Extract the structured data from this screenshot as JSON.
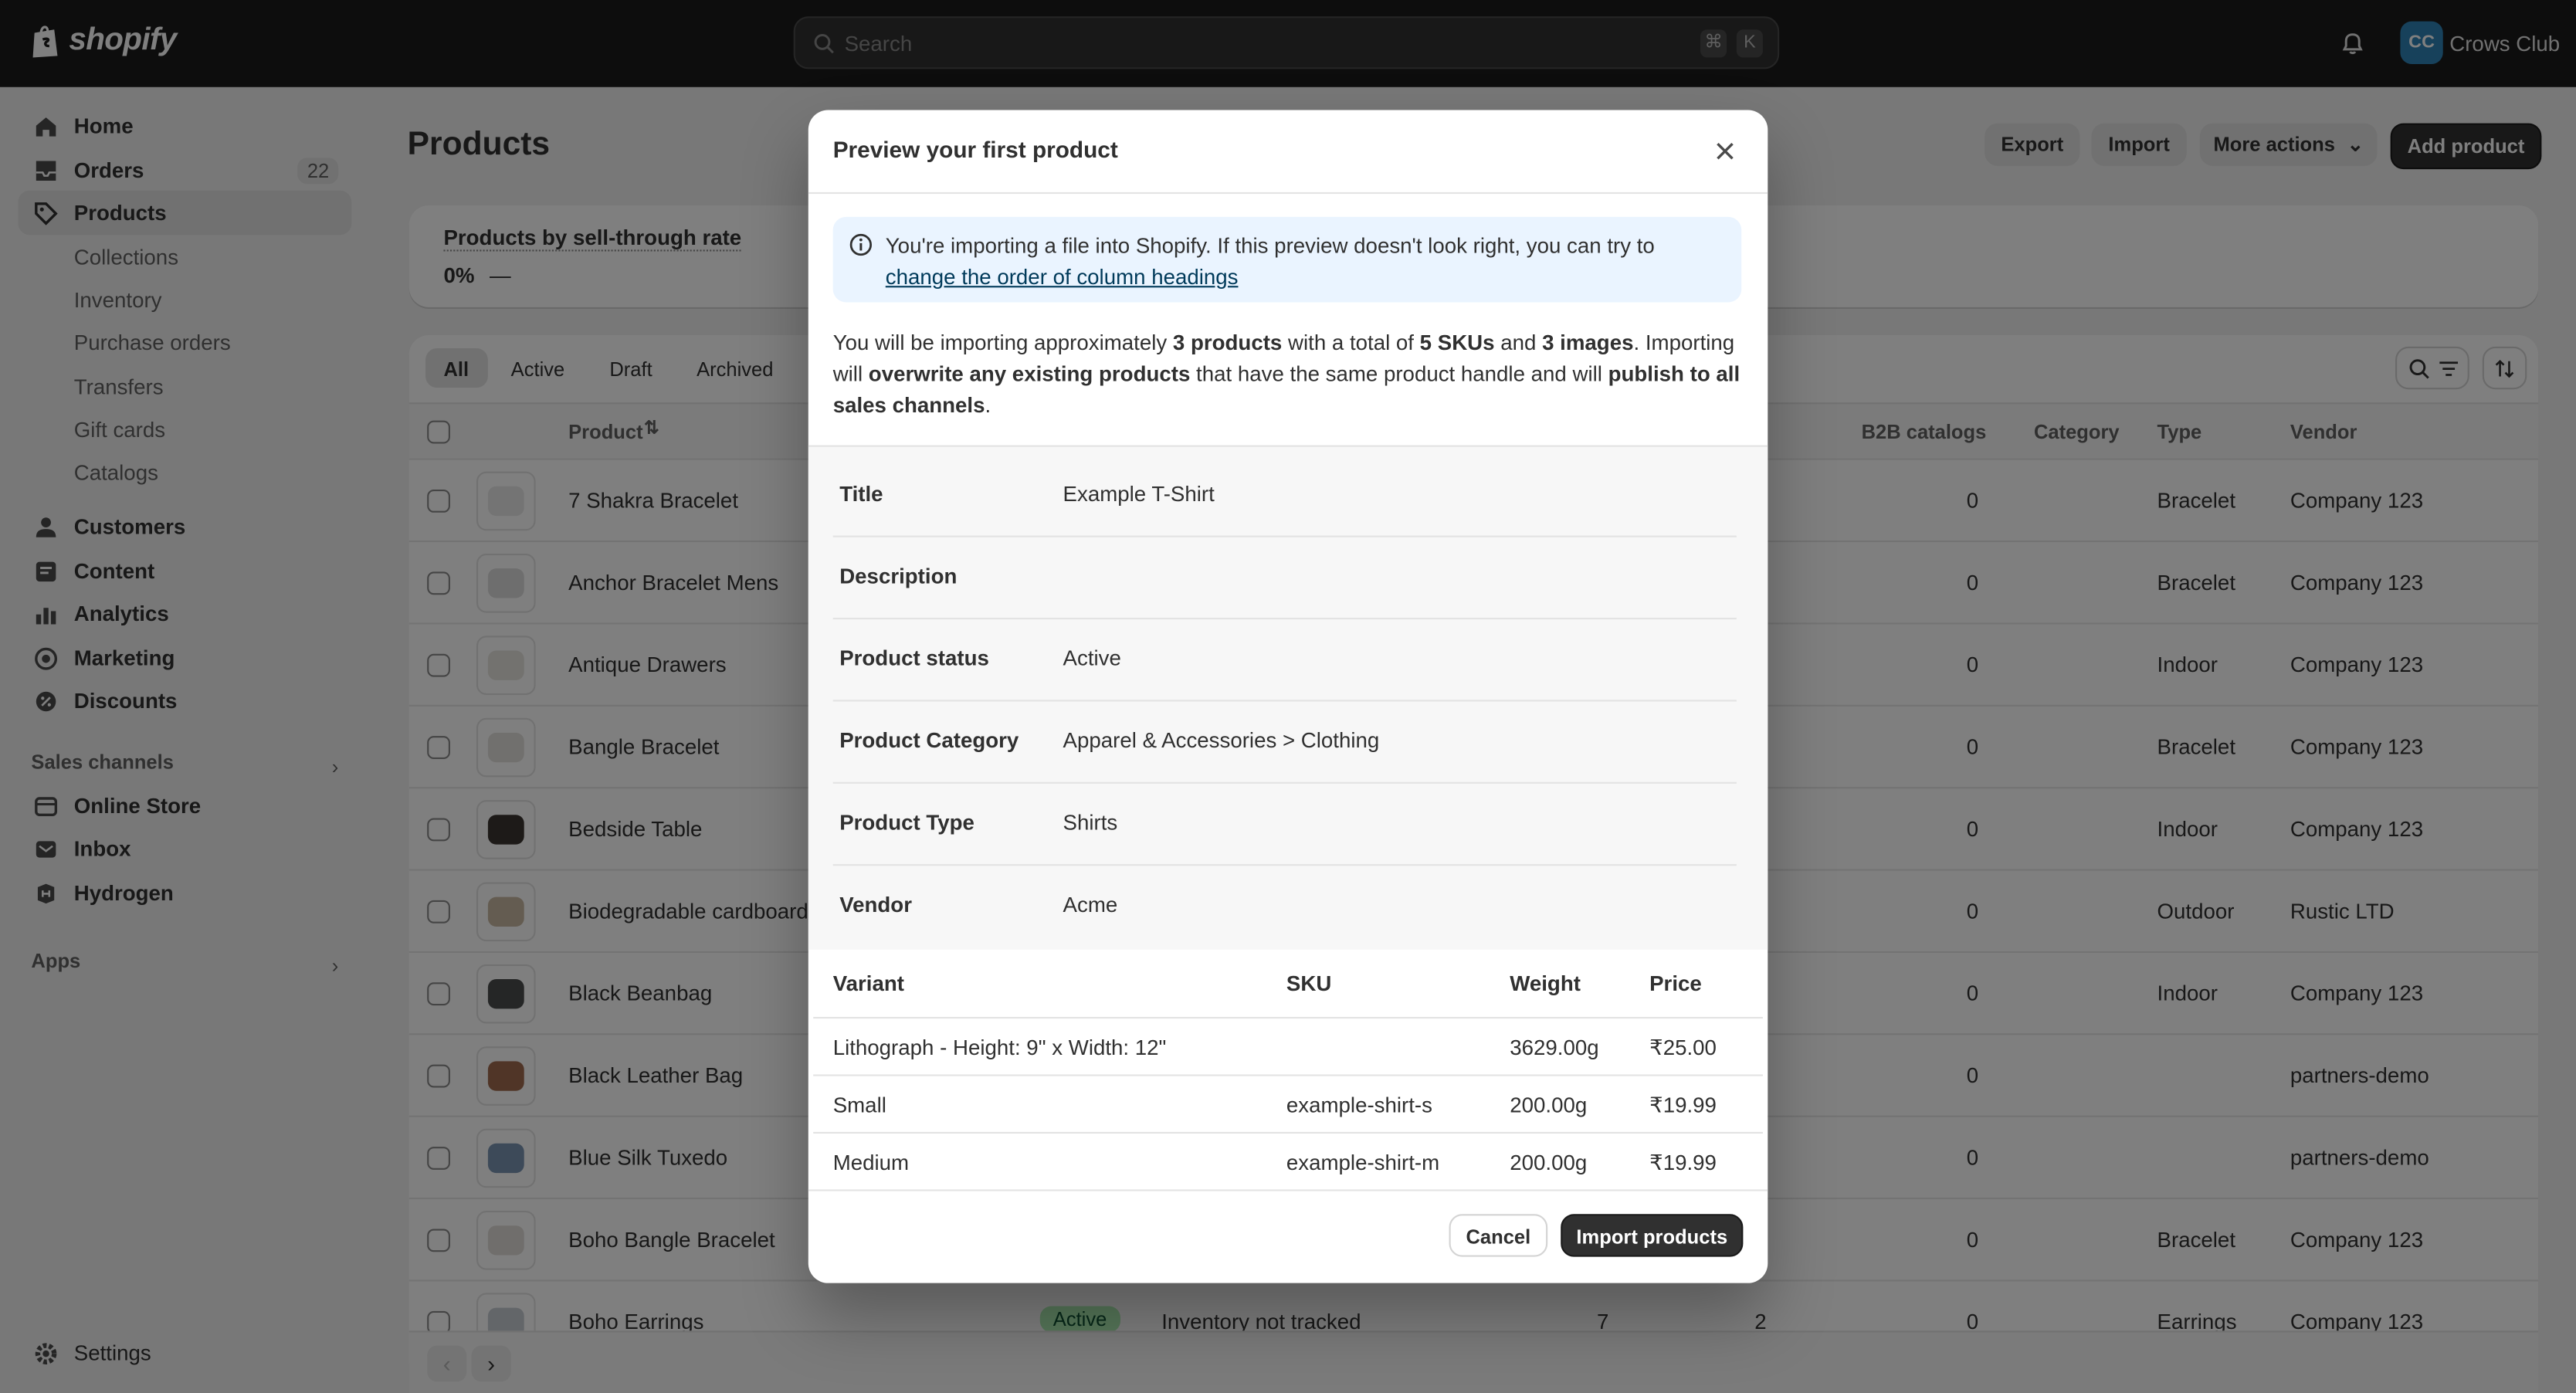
{
  "topbar": {
    "logo_text": "shopify",
    "search_placeholder": "Search",
    "shortcut_cmd": "⌘",
    "shortcut_key": "K",
    "avatar_initials": "CC",
    "store_name": "Crows Club"
  },
  "sidebar": {
    "items": [
      {
        "label": "Home",
        "icon": "home-icon"
      },
      {
        "label": "Orders",
        "icon": "orders-icon",
        "badge": "22"
      },
      {
        "label": "Products",
        "icon": "tag-icon",
        "active": true
      }
    ],
    "product_sub": [
      "Collections",
      "Inventory",
      "Purchase orders",
      "Transfers",
      "Gift cards",
      "Catalogs"
    ],
    "items2": [
      {
        "label": "Customers",
        "icon": "person-icon"
      },
      {
        "label": "Content",
        "icon": "content-icon"
      },
      {
        "label": "Analytics",
        "icon": "chart-icon"
      },
      {
        "label": "Marketing",
        "icon": "target-icon"
      },
      {
        "label": "Discounts",
        "icon": "discount-icon"
      }
    ],
    "sales_channels_heading": "Sales channels",
    "channels": [
      {
        "label": "Online Store",
        "icon": "store-icon"
      },
      {
        "label": "Inbox",
        "icon": "inbox-icon"
      },
      {
        "label": "Hydrogen",
        "icon": "hydrogen-icon"
      }
    ],
    "apps_heading": "Apps",
    "settings_label": "Settings"
  },
  "main": {
    "title": "Products",
    "export_label": "Export",
    "import_label": "Import",
    "more_actions_label": "More actions",
    "add_product_label": "Add product",
    "sell_through": {
      "title": "Products by sell-through rate",
      "value": "0%",
      "dash": "—"
    },
    "tabs": [
      "All",
      "Active",
      "Draft",
      "Archived"
    ],
    "columns": {
      "product": "Product",
      "b2b": "B2B catalogs",
      "category": "Category",
      "type": "Type",
      "vendor": "Vendor"
    },
    "rows": [
      {
        "name": "7 Shakra Bracelet",
        "b2b": "0",
        "type": "Bracelet",
        "vendor": "Company 123",
        "thumb": "#e9e9e9"
      },
      {
        "name": "Anchor Bracelet Mens",
        "b2b": "0",
        "type": "Bracelet",
        "vendor": "Company 123",
        "thumb": "#dcdcdc"
      },
      {
        "name": "Antique Drawers",
        "b2b": "0",
        "type": "Indoor",
        "vendor": "Company 123",
        "thumb": "#e7e4df"
      },
      {
        "name": "Bangle Bracelet",
        "b2b": "0",
        "type": "Bracelet",
        "vendor": "Company 123",
        "thumb": "#e3e1dd"
      },
      {
        "name": "Bedside Table",
        "b2b": "0",
        "type": "Indoor",
        "vendor": "Company 123",
        "thumb": "#3a3530"
      },
      {
        "name": "Biodegradable cardboard",
        "b2b": "0",
        "type": "Outdoor",
        "vendor": "Rustic LTD",
        "thumb": "#c9b9a2"
      },
      {
        "name": "Black Beanbag",
        "b2b": "0",
        "type": "Indoor",
        "vendor": "Company 123",
        "thumb": "#4a4c4d"
      },
      {
        "name": "Black Leather Bag",
        "b2b": "0",
        "type": "",
        "vendor": "partners-demo",
        "thumb": "#a06a4e"
      },
      {
        "name": "Blue Silk Tuxedo",
        "b2b": "0",
        "type": "",
        "vendor": "partners-demo",
        "thumb": "#7b95b3"
      },
      {
        "name": "Boho Bangle Bracelet",
        "b2b": "0",
        "type": "Bracelet",
        "vendor": "Company 123",
        "thumb": "#e0ddd8"
      },
      {
        "name": "Boho Earrings",
        "status": "Active",
        "inventory": "Inventory not tracked",
        "col7": "7",
        "col2": "2",
        "b2b": "0",
        "type": "Earrings",
        "vendor": "Company 123",
        "thumb": "#c7cdd3"
      }
    ]
  },
  "modal": {
    "title": "Preview your first product",
    "banner_text": "You're importing a file into Shopify. If this preview doesn't look right, you can try to",
    "banner_link": "change the order of column headings",
    "summary": {
      "p1": "You will be importing approximately ",
      "b1": "3 products",
      "p2": " with a total of ",
      "b2": "5 SKUs",
      "p3": " and ",
      "b3": "3 images",
      "p4": ". Importing will ",
      "b4": "overwrite any existing products",
      "p5": " that have the same product handle and will ",
      "b5": "publish to all sales channels",
      "p6": "."
    },
    "fields": [
      {
        "label": "Title",
        "value": "Example T-Shirt"
      },
      {
        "label": "Description",
        "value": ""
      },
      {
        "label": "Product status",
        "value": "Active"
      },
      {
        "label": "Product Category",
        "value": "Apparel & Accessories > Clothing"
      },
      {
        "label": "Product Type",
        "value": "Shirts"
      },
      {
        "label": "Vendor",
        "value": "Acme"
      }
    ],
    "variant_headers": {
      "variant": "Variant",
      "sku": "SKU",
      "weight": "Weight",
      "price": "Price"
    },
    "variants": [
      {
        "variant": "Lithograph - Height: 9\" x Width: 12\"",
        "sku": "",
        "weight": "3629.00g",
        "price": "₹25.00"
      },
      {
        "variant": "Small",
        "sku": "example-shirt-s",
        "weight": "200.00g",
        "price": "₹19.99"
      },
      {
        "variant": "Medium",
        "sku": "example-shirt-m",
        "weight": "200.00g",
        "price": "₹19.99"
      }
    ],
    "cancel_label": "Cancel",
    "import_label": "Import products"
  }
}
